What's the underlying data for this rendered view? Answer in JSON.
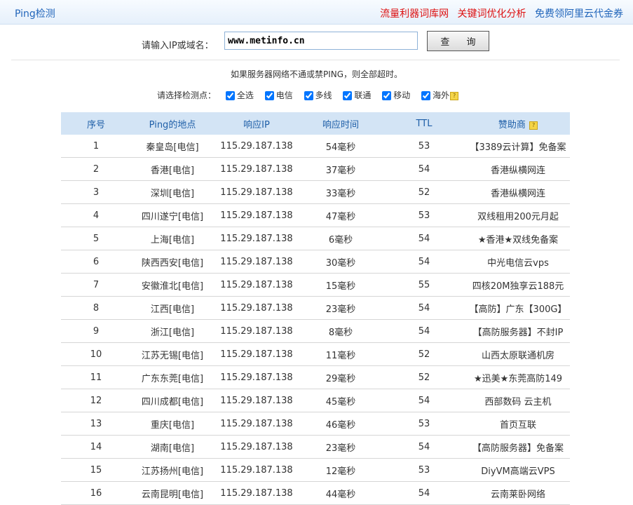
{
  "header": {
    "title": "Ping检测",
    "links": [
      "流量利器词库网",
      "关键词优化分析",
      "免费领阿里云代金券"
    ]
  },
  "search": {
    "label": "请输入IP或域名：",
    "value": "www.metinfo.cn",
    "button_label": "查 询"
  },
  "notice": "如果服务器网络不通或禁PING，则全部超时。",
  "points": {
    "label": "请选择检测点：",
    "options": [
      {
        "label": "全选",
        "checked": true
      },
      {
        "label": "电信",
        "checked": true
      },
      {
        "label": "多线",
        "checked": true
      },
      {
        "label": "联通",
        "checked": true
      },
      {
        "label": "移动",
        "checked": true
      },
      {
        "label": "海外",
        "checked": true
      }
    ]
  },
  "table": {
    "headers": [
      "序号",
      "Ping的地点",
      "响应IP",
      "响应时间",
      "TTL",
      "赞助商"
    ],
    "rows": [
      [
        "1",
        "秦皇岛[电信]",
        "115.29.187.138",
        "54毫秒",
        "53",
        "【3389云计算】免备案"
      ],
      [
        "2",
        "香港[电信]",
        "115.29.187.138",
        "37毫秒",
        "54",
        "香港纵横网连"
      ],
      [
        "3",
        "深圳[电信]",
        "115.29.187.138",
        "33毫秒",
        "52",
        "香港纵横网连"
      ],
      [
        "4",
        "四川遂宁[电信]",
        "115.29.187.138",
        "47毫秒",
        "53",
        "双线租用200元月起"
      ],
      [
        "5",
        "上海[电信]",
        "115.29.187.138",
        "6毫秒",
        "54",
        "★香港★双线免备案"
      ],
      [
        "6",
        "陕西西安[电信]",
        "115.29.187.138",
        "30毫秒",
        "54",
        "中光电信云vps"
      ],
      [
        "7",
        "安徽淮北[电信]",
        "115.29.187.138",
        "15毫秒",
        "55",
        "四核20M独享云188元"
      ],
      [
        "8",
        "江西[电信]",
        "115.29.187.138",
        "23毫秒",
        "54",
        "【高防】广东【300G】"
      ],
      [
        "9",
        "浙江[电信]",
        "115.29.187.138",
        "8毫秒",
        "54",
        "【高防服务器】不封IP"
      ],
      [
        "10",
        "江苏无锡[电信]",
        "115.29.187.138",
        "11毫秒",
        "52",
        "山西太原联通机房"
      ],
      [
        "11",
        "广东东莞[电信]",
        "115.29.187.138",
        "29毫秒",
        "52",
        "★迅美★东莞高防149"
      ],
      [
        "12",
        "四川成都[电信]",
        "115.29.187.138",
        "45毫秒",
        "54",
        "西部数码 云主机"
      ],
      [
        "13",
        "重庆[电信]",
        "115.29.187.138",
        "46毫秒",
        "53",
        "首页互联"
      ],
      [
        "14",
        "湖南[电信]",
        "115.29.187.138",
        "23毫秒",
        "54",
        "【高防服务器】免备案"
      ],
      [
        "15",
        "江苏扬州[电信]",
        "115.29.187.138",
        "12毫秒",
        "53",
        "DiyVM高端云VPS"
      ],
      [
        "16",
        "云南昆明[电信]",
        "115.29.187.138",
        "44毫秒",
        "54",
        "云南莱卧网络"
      ]
    ]
  },
  "colors": {
    "link_blue": "#2266bb",
    "link_red": "#dd1111",
    "ip_green": "#138c2e",
    "header_bg": "#d3e4f5"
  },
  "icons": {
    "help": "help-icon"
  }
}
